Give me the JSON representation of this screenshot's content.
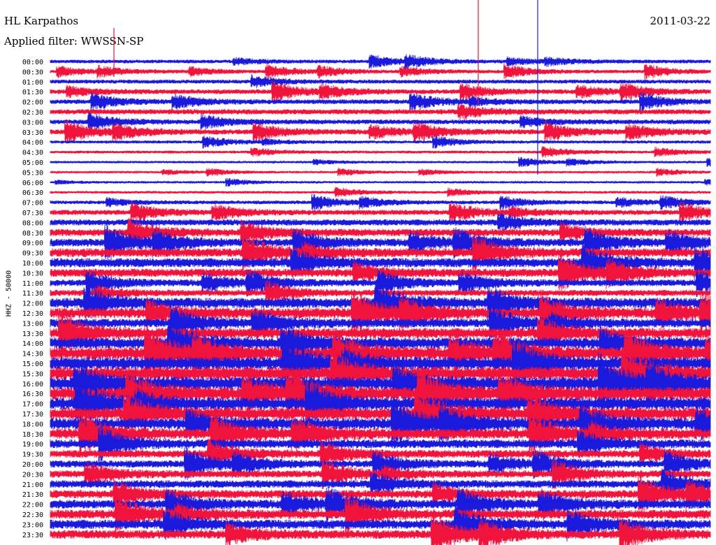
{
  "header": {
    "title": "HL Karpathos",
    "date": "2011-03-22",
    "filter": "Applied filter: WWSSN-SP"
  },
  "chart_data": {
    "type": "line",
    "title": "HL Karpathos",
    "subtitle": "Applied filter: WWSSN-SP",
    "ylabel": "HHZ - 50000",
    "xlabel": "",
    "row_labels": [
      "00:00",
      "00:30",
      "01:00",
      "01:30",
      "02:00",
      "02:30",
      "03:00",
      "03:30",
      "04:00",
      "04:30",
      "05:00",
      "05:30",
      "06:00",
      "06:30",
      "07:00",
      "07:30",
      "08:00",
      "08:30",
      "09:00",
      "09:30",
      "10:00",
      "10:30",
      "11:00",
      "11:30",
      "12:00",
      "12:30",
      "13:00",
      "13:30",
      "14:00",
      "14:30",
      "15:00",
      "15:30",
      "16:00",
      "16:30",
      "17:00",
      "17:30",
      "18:00",
      "18:30",
      "19:00",
      "19:30",
      "20:00",
      "20:30",
      "21:00",
      "21:30",
      "22:00",
      "22:30",
      "23:00",
      "23:30"
    ],
    "row_colors": [
      "#1a1adc",
      "#f0143c"
    ],
    "relative_amplitude": [
      0.35,
      0.33,
      0.38,
      0.45,
      0.45,
      0.5,
      0.45,
      0.5,
      0.3,
      0.28,
      0.22,
      0.2,
      0.2,
      0.25,
      0.35,
      0.5,
      0.6,
      0.7,
      0.75,
      0.85,
      0.9,
      0.8,
      0.65,
      0.6,
      1.0,
      1.0,
      0.85,
      1.0,
      1.1,
      1.2,
      1.25,
      1.3,
      1.3,
      1.25,
      1.2,
      1.2,
      1.1,
      1.0,
      0.85,
      0.75,
      0.7,
      0.7,
      0.75,
      0.8,
      0.85,
      0.9,
      0.9,
      0.85
    ],
    "grid": false,
    "legend": "none"
  }
}
